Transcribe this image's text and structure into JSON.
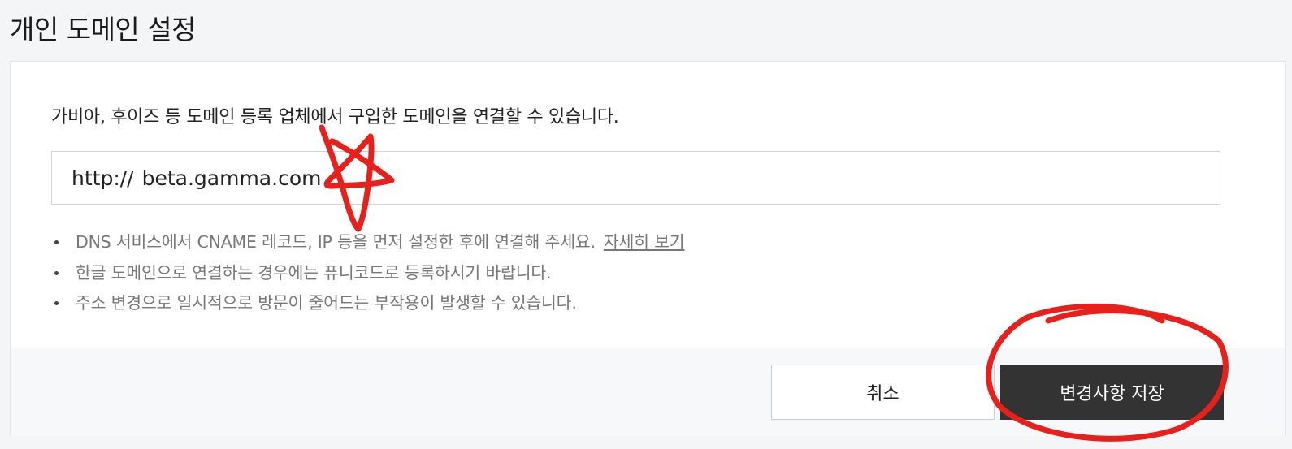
{
  "page": {
    "title": "개인 도메인 설정"
  },
  "form": {
    "description": "가비아, 후이즈 등 도메인 등록 업체에서 구입한 도메인을 연결할 수 있습니다.",
    "domain_prefix": "http://",
    "domain_value": "beta.gamma.com"
  },
  "notes": [
    {
      "text": "DNS 서비스에서 CNAME 레코드, IP 등을 먼저 설정한 후에 연결해 주세요.",
      "link": "자세히 보기"
    },
    {
      "text": "한글 도메인으로 연결하는 경우에는 퓨니코드로 등록하시기 바랍니다."
    },
    {
      "text": "주소 변경으로 일시적으로 방문이 줄어드는 부작용이 발생할 수 있습니다."
    }
  ],
  "footer": {
    "cancel_label": "취소",
    "save_label": "변경사항 저장"
  },
  "colors": {
    "annotation": "#e8201c",
    "save_button": "#333333",
    "page_background": "#f4f5f7"
  }
}
